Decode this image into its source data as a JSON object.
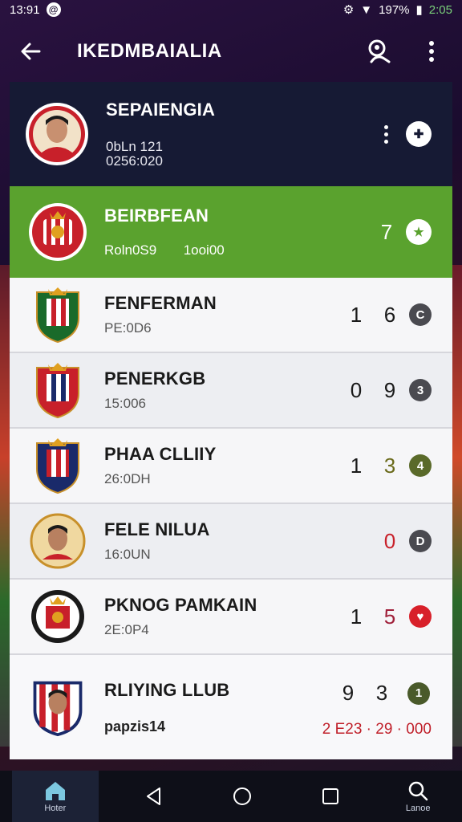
{
  "status_bar": {
    "time": "13:91",
    "signal_text": "197%",
    "battery_text": "2:05"
  },
  "app_bar": {
    "title": "IKEDMBAIALIA"
  },
  "profile": {
    "name": "SEPAIENGIA",
    "line1": "0bLn 121",
    "line2": "0256:020"
  },
  "highlight": {
    "name": "BEIRBFEAN",
    "sub_left": "Roln0S9",
    "sub_right": "1ooi00",
    "score": "7"
  },
  "rows": [
    {
      "name": "FENFERMAN",
      "sub": "PE:0D6",
      "s1": "1",
      "s2": "6",
      "badge": "C",
      "badge_color": "#4a4a50",
      "s2_color": "#1a1a1a"
    },
    {
      "name": "PENERKGB",
      "sub": "15:006",
      "s1": "0",
      "s2": "9",
      "badge": "3",
      "badge_color": "#4a4a50",
      "s2_color": "#1a1a1a"
    },
    {
      "name": "PHAA CLLIIY",
      "sub": "26:0DH",
      "s1": "1",
      "s2": "3",
      "badge": "4",
      "badge_color": "#5a6a2a",
      "s2_color": "#6a6a1a"
    },
    {
      "name": "FELE NILUA",
      "sub": "16:0UN",
      "s1": "",
      "s2": "0",
      "badge": "D",
      "badge_color": "#4a4a50",
      "s2_color": "#c8202a"
    },
    {
      "name": "PKNOG PAMKAIN",
      "sub": "2E:0P4",
      "s1": "1",
      "s2": "5",
      "badge": "♥",
      "badge_color": "#d8202a",
      "s2_color": "#a0203a"
    }
  ],
  "last_row": {
    "name": "RLIYING LLUB",
    "sub": "papzis14",
    "s1": "9",
    "s2": "3",
    "badge": "1",
    "extra": "2 E23 · 29 · 000"
  },
  "nav": {
    "home_label": "Hoter",
    "search_label": "Lanoe"
  },
  "colors": {
    "highlight_green": "#5aa22e",
    "profile_bg": "#161a34",
    "accent_red": "#c8202a"
  }
}
